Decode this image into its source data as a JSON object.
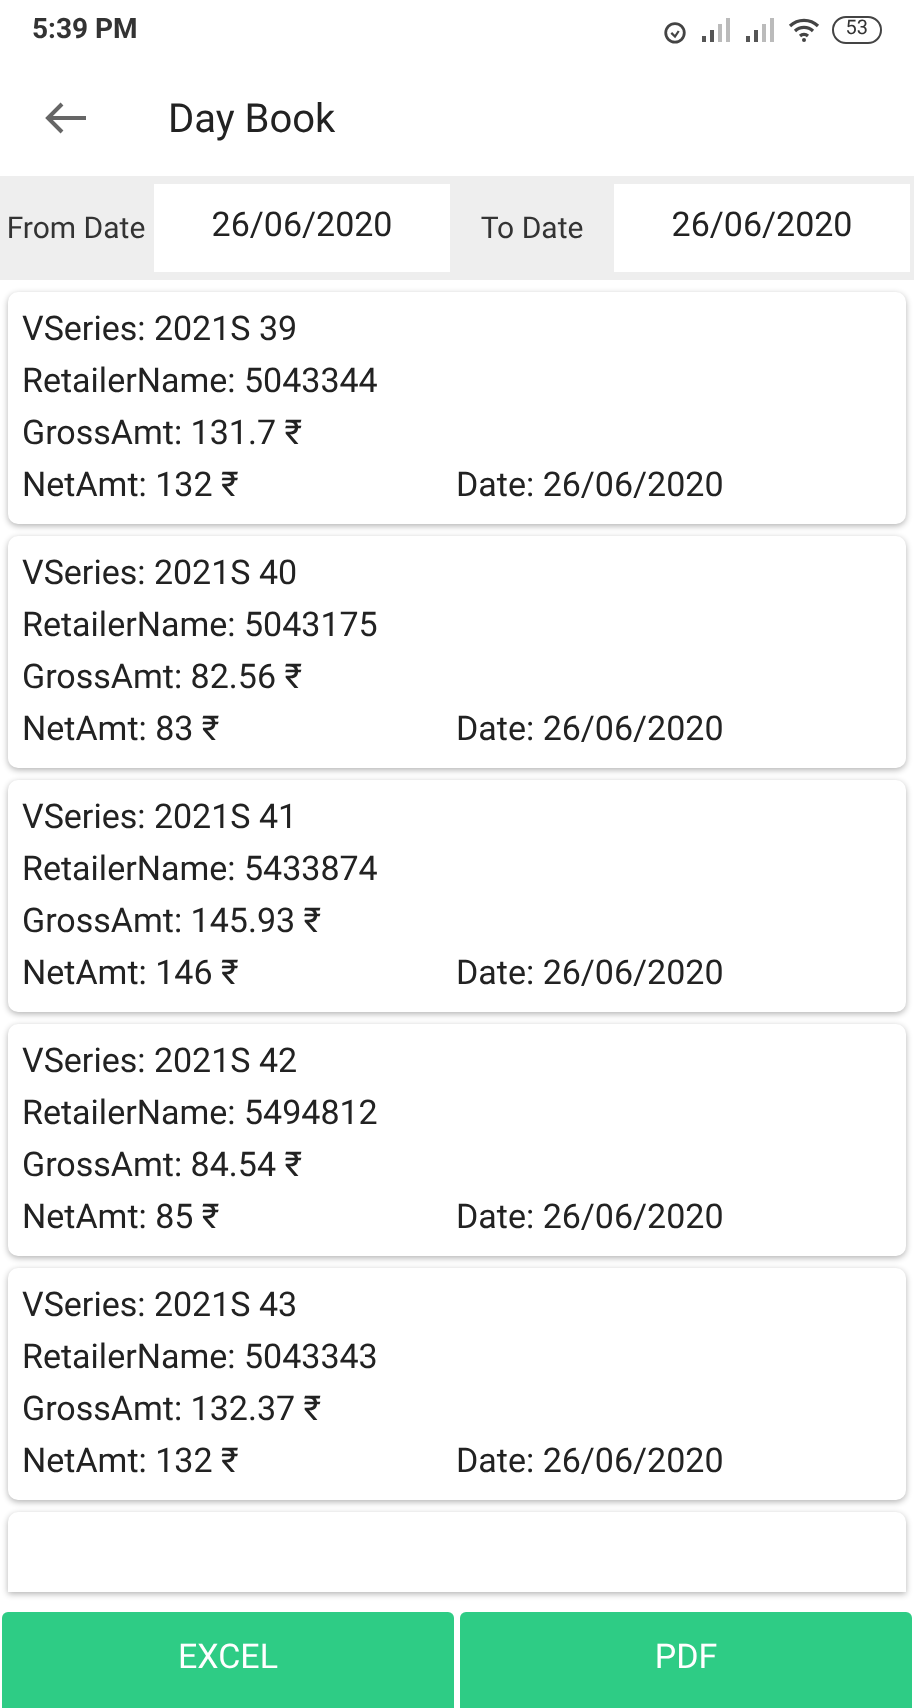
{
  "status_bar": {
    "time": "5:39 PM",
    "battery": "53"
  },
  "header": {
    "title": "Day Book"
  },
  "filters": {
    "from_label": "From Date",
    "from_value": "26/06/2020",
    "to_label": "To Date",
    "to_value": "26/06/2020"
  },
  "entries": [
    {
      "vseries": "VSeries: 2021S 39",
      "retailer": "RetailerName: 5043344",
      "gross": "GrossAmt: 131.7 ₹",
      "net": "NetAmt: 132 ₹",
      "date": "Date: 26/06/2020"
    },
    {
      "vseries": "VSeries: 2021S 40",
      "retailer": "RetailerName: 5043175",
      "gross": "GrossAmt: 82.56 ₹",
      "net": "NetAmt: 83 ₹",
      "date": "Date: 26/06/2020"
    },
    {
      "vseries": "VSeries: 2021S 41",
      "retailer": "RetailerName: 5433874",
      "gross": "GrossAmt: 145.93 ₹",
      "net": "NetAmt: 146 ₹",
      "date": "Date: 26/06/2020"
    },
    {
      "vseries": "VSeries: 2021S 42",
      "retailer": "RetailerName: 5494812",
      "gross": "GrossAmt: 84.54 ₹",
      "net": "NetAmt: 85 ₹",
      "date": "Date: 26/06/2020"
    },
    {
      "vseries": "VSeries: 2021S 43",
      "retailer": "RetailerName: 5043343",
      "gross": "GrossAmt: 132.37 ₹",
      "net": "NetAmt: 132 ₹",
      "date": "Date: 26/06/2020"
    }
  ],
  "buttons": [
    "EXCEL",
    "PDF"
  ]
}
